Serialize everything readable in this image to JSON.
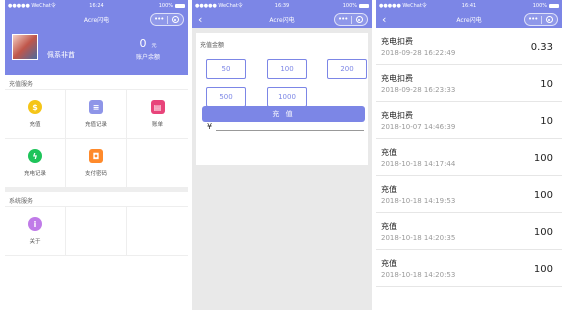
{
  "theme": {
    "accent": "#7c86e6"
  },
  "app_title": "Acre闪电",
  "screens": {
    "home": {
      "status": {
        "carrier": "●●●●● WeChat令",
        "time": "16:24",
        "battery": "100%"
      },
      "profile": {
        "name": "佩系非酋",
        "balance_value": "0",
        "balance_unit": "元",
        "balance_label": "账户余额"
      },
      "recharge_section": "充值服务",
      "recharge_items": [
        {
          "label": "充值",
          "icon": "money-bag-icon",
          "color": "#f5c518"
        },
        {
          "label": "充值记录",
          "icon": "record-icon",
          "color": "#8e95e8"
        },
        {
          "label": "账单",
          "icon": "bill-icon",
          "color": "#e8447a"
        },
        {
          "label": "充电记录",
          "icon": "lightning-icon",
          "color": "#1ec45a"
        },
        {
          "label": "支付密码",
          "icon": "lock-icon",
          "color": "#ff8a2b"
        }
      ],
      "system_section": "系统服务",
      "system_items": [
        {
          "label": "关于",
          "icon": "info-icon",
          "color": "#c07be8"
        }
      ]
    },
    "recharge": {
      "status": {
        "carrier": "●●●●● WeChat令",
        "time": "16:39",
        "battery": "100%"
      },
      "amount_title": "充值金额",
      "amounts": [
        "50",
        "100",
        "200",
        "500",
        "1000"
      ],
      "currency": "¥",
      "pay_button": "充 值"
    },
    "records": {
      "status": {
        "carrier": "●●●●● WeChat令",
        "time": "16:41",
        "battery": "100%"
      },
      "items": [
        {
          "title": "充电扣费",
          "date": "2018-09-28 16:22:49",
          "value": "0.33"
        },
        {
          "title": "充电扣费",
          "date": "2018-09-28 16:23:33",
          "value": "10"
        },
        {
          "title": "充电扣费",
          "date": "2018-10-07 14:46:39",
          "value": "10"
        },
        {
          "title": "充值",
          "date": "2018-10-18 14:17:44",
          "value": "100"
        },
        {
          "title": "充值",
          "date": "2018-10-18 14:19:53",
          "value": "100"
        },
        {
          "title": "充值",
          "date": "2018-10-18 14:20:35",
          "value": "100"
        },
        {
          "title": "充值",
          "date": "2018-10-18 14:20:53",
          "value": "100"
        }
      ]
    }
  }
}
